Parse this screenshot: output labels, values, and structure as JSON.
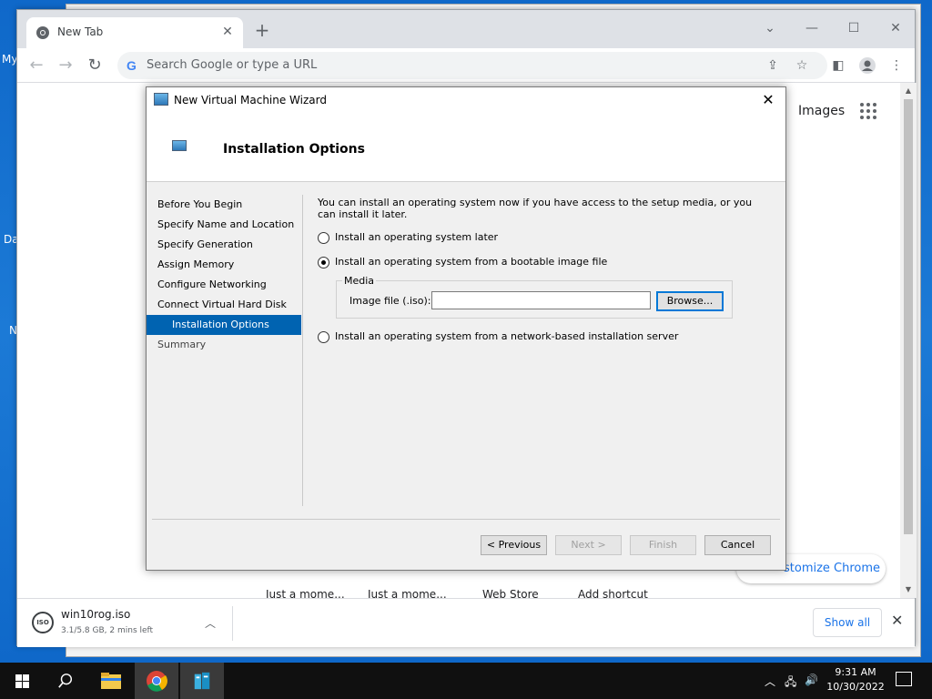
{
  "desktop": {
    "icon_labels": [
      "My",
      "Da",
      "N"
    ]
  },
  "browser": {
    "tab_title": "New Tab",
    "omnibox_placeholder": "Search Google or type a URL",
    "images_link": "Images",
    "shortcuts": [
      "Just a mome...",
      "Just a mome...",
      "Web Store",
      "Add shortcut"
    ],
    "customize_label": "stomize Chrome",
    "download": {
      "icon_text": "ISO",
      "filename": "win10rog.iso",
      "status": "3.1/5.8 GB, 2 mins left",
      "show_all": "Show all"
    }
  },
  "wizard": {
    "window_title": "New Virtual Machine Wizard",
    "page_title": "Installation Options",
    "steps": [
      "Before You Begin",
      "Specify Name and Location",
      "Specify Generation",
      "Assign Memory",
      "Configure Networking",
      "Connect Virtual Hard Disk",
      "Installation Options",
      "Summary"
    ],
    "active_step": "Installation Options",
    "intro": "You can install an operating system now if you have access to the setup media, or you can install it later.",
    "options": {
      "later": "Install an operating system later",
      "image": "Install an operating system from a bootable image file",
      "network": "Install an operating system from a network-based installation server"
    },
    "selected_option": "image",
    "media_label": "Media",
    "iso_label": "Image file (.iso):",
    "iso_value": "",
    "browse": "Browse...",
    "buttons": {
      "previous": "< Previous",
      "next": "Next >",
      "finish": "Finish",
      "cancel": "Cancel"
    }
  },
  "taskbar": {
    "time": "9:31 AM",
    "date": "10/30/2022"
  },
  "colors": {
    "accent": "#0063b1",
    "desktop": "#1c7ad6",
    "chrome_link": "#1a73e8"
  }
}
